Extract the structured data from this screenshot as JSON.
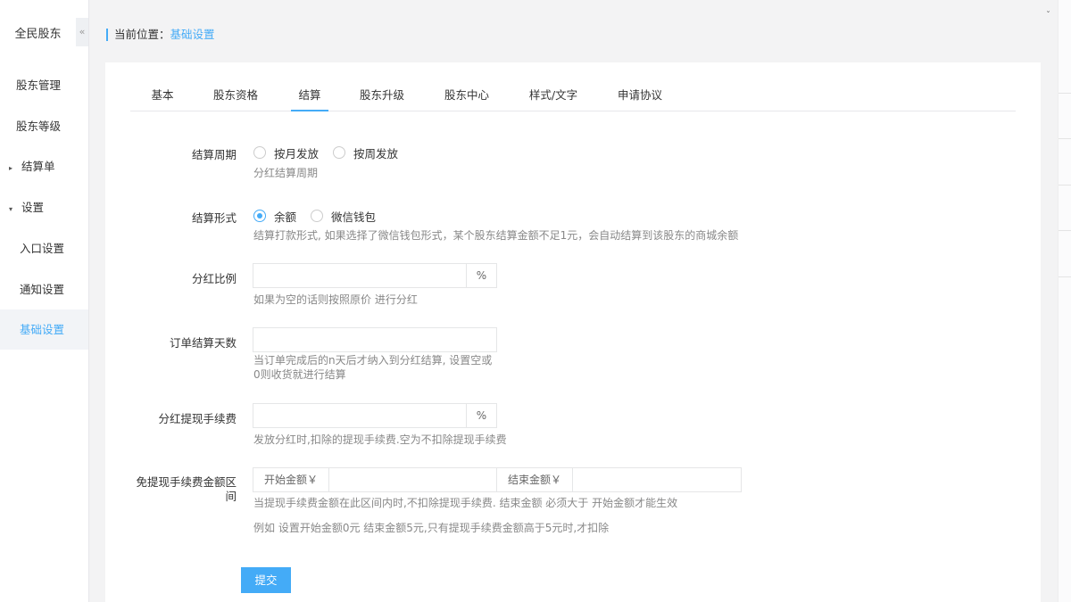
{
  "sidebar": {
    "brand": "全民股东",
    "collapse": "«",
    "items": [
      {
        "label": "股东管理"
      },
      {
        "label": "股东等级"
      },
      {
        "label": "结算单",
        "caret": "▸"
      },
      {
        "label": "设置",
        "caret": "▾"
      },
      {
        "label": "入口设置"
      },
      {
        "label": "通知设置"
      },
      {
        "label": "基础设置"
      }
    ]
  },
  "breadcrumb": {
    "prefix": "当前位置：",
    "current": "基础设置"
  },
  "top_chevron": "ˇ",
  "tabs": [
    "基本",
    "股东资格",
    "结算",
    "股东升级",
    "股东中心",
    "样式/文字",
    "申请协议"
  ],
  "form": {
    "cycle": {
      "label": "结算周期",
      "options": [
        "按月发放",
        "按周发放"
      ],
      "help": "分红结算周期"
    },
    "form_type": {
      "label": "结算形式",
      "options": [
        "余额",
        "微信钱包"
      ],
      "selected": "余额",
      "help": "结算打款形式, 如果选择了微信钱包形式，某个股东结算金额不足1元，会自动结算到该股东的商城余额"
    },
    "ratio": {
      "label": "分红比例",
      "value": "",
      "suffix": "%",
      "help": "如果为空的话则按照原价 进行分红"
    },
    "days": {
      "label": "订单结算天数",
      "value": "",
      "help_line1": "当订单完成后的n天后才纳入到分红结算, 设置空或",
      "help_line2": "0则收货就进行结算"
    },
    "fee": {
      "label": "分红提现手续费",
      "value": "",
      "suffix": "%",
      "help": "发放分红时,扣除的提现手续费.空为不扣除提现手续费"
    },
    "range": {
      "label_line1": "免提现手续费金额区",
      "label_line2": "间",
      "start_label": "开始金额￥",
      "start_value": "",
      "end_label": "结束金额￥",
      "end_value": "",
      "help1": "当提现手续费金额在此区间内时,不扣除提现手续费. 结束金额 必须大于 开始金额才能生效",
      "help2": "例如 设置开始金额0元 结束金额5元,只有提现手续费金额高于5元时,才扣除"
    },
    "submit": "提交"
  },
  "colors": {
    "accent": "#44abf7"
  }
}
